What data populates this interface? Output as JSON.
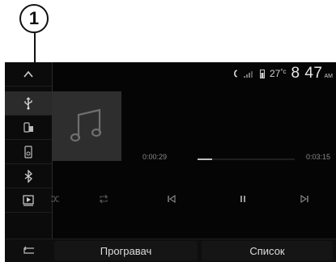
{
  "callout": {
    "number": "1"
  },
  "sidebar": {
    "items": [
      {
        "name": "chevron-up-icon"
      },
      {
        "name": "usb-icon",
        "active": true
      },
      {
        "name": "phone-transfer-icon"
      },
      {
        "name": "ipod-icon"
      },
      {
        "name": "bluetooth-icon"
      },
      {
        "name": "video-source-icon"
      }
    ]
  },
  "status": {
    "temperature": "27",
    "temp_unit": "°c",
    "time": "8 47",
    "ampm": "AM"
  },
  "player": {
    "elapsed": "0:00:29",
    "total": "0:03:15",
    "progress_fraction": 0.15
  },
  "controls": {
    "icons": [
      "shuffle-icon",
      "repeat-icon",
      "previous-track-icon",
      "pause-icon",
      "next-track-icon"
    ]
  },
  "bottom": {
    "player_label": "Програвач",
    "list_label": "Список"
  }
}
